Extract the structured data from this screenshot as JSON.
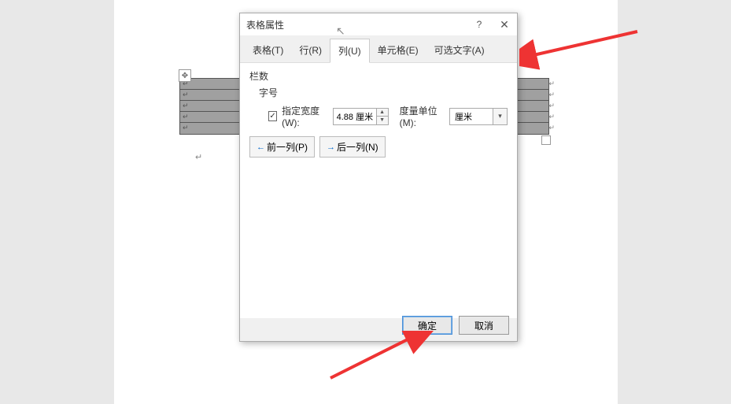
{
  "dialog": {
    "title": "表格属性",
    "help": "?",
    "tabs": {
      "table": "表格(T)",
      "row": "行(R)",
      "column": "列(U)",
      "cell": "单元格(E)",
      "alttext": "可选文字(A)"
    },
    "section": {
      "heading": "栏数",
      "subheading": "字号",
      "widthCheckLabel": "指定宽度(W):",
      "widthValue": "4.88 厘米",
      "unitLabel": "度量单位(M):",
      "unitValue": "厘米"
    },
    "nav": {
      "prev": "前一列(P)",
      "next": "后一列(N)"
    },
    "buttons": {
      "ok": "确定",
      "cancel": "取消"
    }
  },
  "checkmark": "✓"
}
